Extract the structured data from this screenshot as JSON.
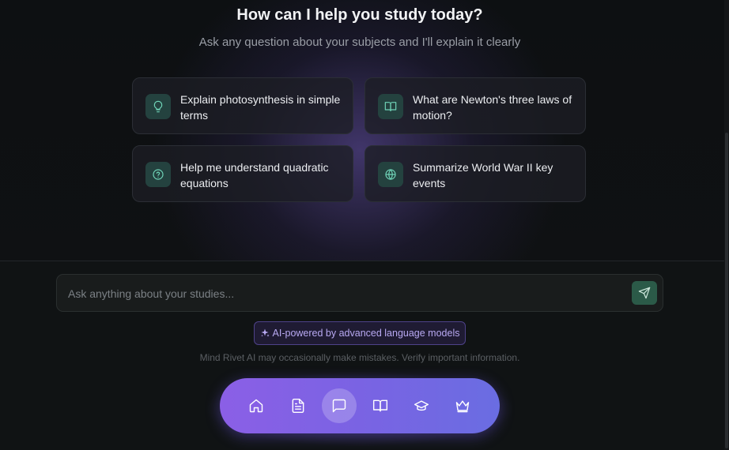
{
  "hero": {
    "title": "How can I help you study today?",
    "subtitle": "Ask any question about your subjects and I'll explain it clearly"
  },
  "suggestions": [
    {
      "text": "Explain photosynthesis in simple terms",
      "icon": "lightbulb-icon"
    },
    {
      "text": "What are Newton's three laws of motion?",
      "icon": "book-icon"
    },
    {
      "text": "Help me understand quadratic equations",
      "icon": "help-circle-icon"
    },
    {
      "text": "Summarize World War II key events",
      "icon": "globe-icon"
    }
  ],
  "composer": {
    "placeholder": "Ask anything about your studies...",
    "value": "",
    "send_icon": "send-icon"
  },
  "badge": {
    "text": "AI-powered by advanced language models",
    "icon": "sparkles-icon"
  },
  "disclaimer": "Mind Rivet AI may occasionally make mistakes. Verify important information.",
  "nav": {
    "items": [
      {
        "icon": "home-icon",
        "active": false
      },
      {
        "icon": "document-icon",
        "active": false
      },
      {
        "icon": "chat-icon",
        "active": true
      },
      {
        "icon": "book-open-icon",
        "active": false
      },
      {
        "icon": "graduation-cap-icon",
        "active": false
      },
      {
        "icon": "crown-icon",
        "active": false
      }
    ]
  },
  "colors": {
    "accent_green": "#6fd3b7",
    "nav_gradient_start": "#8b5fe6",
    "nav_gradient_end": "#6a6de2",
    "badge_text": "#b8a9f2"
  }
}
